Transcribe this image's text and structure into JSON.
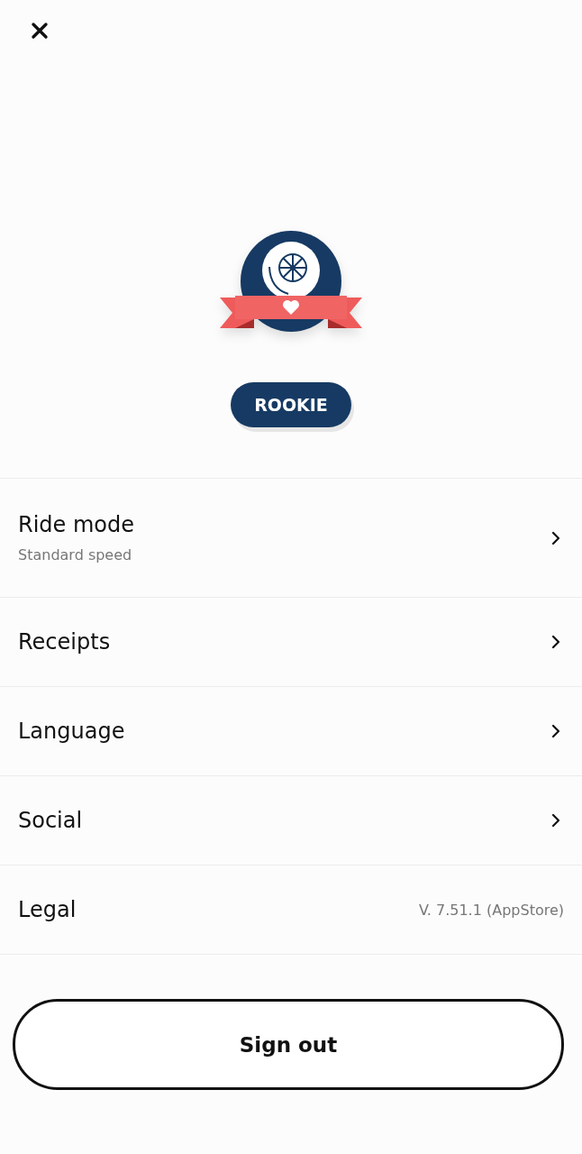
{
  "level_badge": {
    "label": "ROOKIE"
  },
  "menu": [
    {
      "kind": "link",
      "title": "Ride mode",
      "subtitle": "Standard speed"
    },
    {
      "kind": "link",
      "title": "Receipts"
    },
    {
      "kind": "link",
      "title": "Language"
    },
    {
      "kind": "link",
      "title": "Social"
    },
    {
      "kind": "info",
      "title": "Legal",
      "detail": "V. 7.51.1 (AppStore)"
    }
  ],
  "sign_out_button": {
    "label": "Sign out"
  }
}
